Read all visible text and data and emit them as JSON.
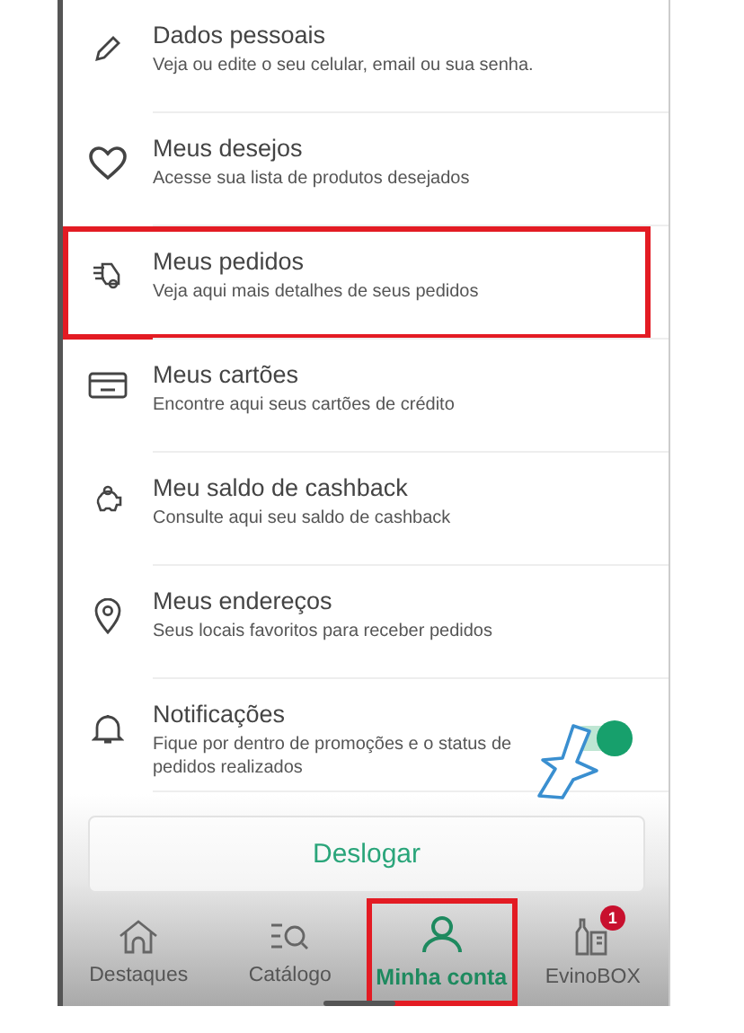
{
  "menu": [
    {
      "title": "Dados pessoais",
      "subtitle": "Veja ou edite o seu celular, email ou sua senha.",
      "kind": "link",
      "highlighted": false
    },
    {
      "title": "Meus desejos",
      "subtitle": "Acesse sua lista de produtos desejados",
      "kind": "link",
      "highlighted": false
    },
    {
      "title": "Meus pedidos",
      "subtitle": "Veja aqui mais detalhes de seus pedidos",
      "kind": "link",
      "highlighted": true
    },
    {
      "title": "Meus cartões",
      "subtitle": "Encontre aqui seus cartões de crédito",
      "kind": "link",
      "highlighted": false
    },
    {
      "title": "Meu saldo de cashback",
      "subtitle": "Consulte aqui seu saldo de cashback",
      "kind": "link",
      "highlighted": false
    },
    {
      "title": "Meus endereços",
      "subtitle": "Seus locais favoritos para receber pedidos",
      "kind": "link",
      "highlighted": false
    },
    {
      "title": "Notificações",
      "subtitle": "Fique por dentro de promoções e o status de pedidos realizados",
      "kind": "toggle",
      "on": true,
      "highlighted": false
    }
  ],
  "logout_button": "Deslogar",
  "tabs": [
    {
      "label": "Destaques",
      "selected": false,
      "highlighted": false
    },
    {
      "label": "Catálogo",
      "selected": false,
      "highlighted": false
    },
    {
      "label": "Minha conta",
      "selected": true,
      "highlighted": true
    },
    {
      "label": "EvinoBOX",
      "selected": false,
      "highlighted": false,
      "badge": "1"
    }
  ]
}
